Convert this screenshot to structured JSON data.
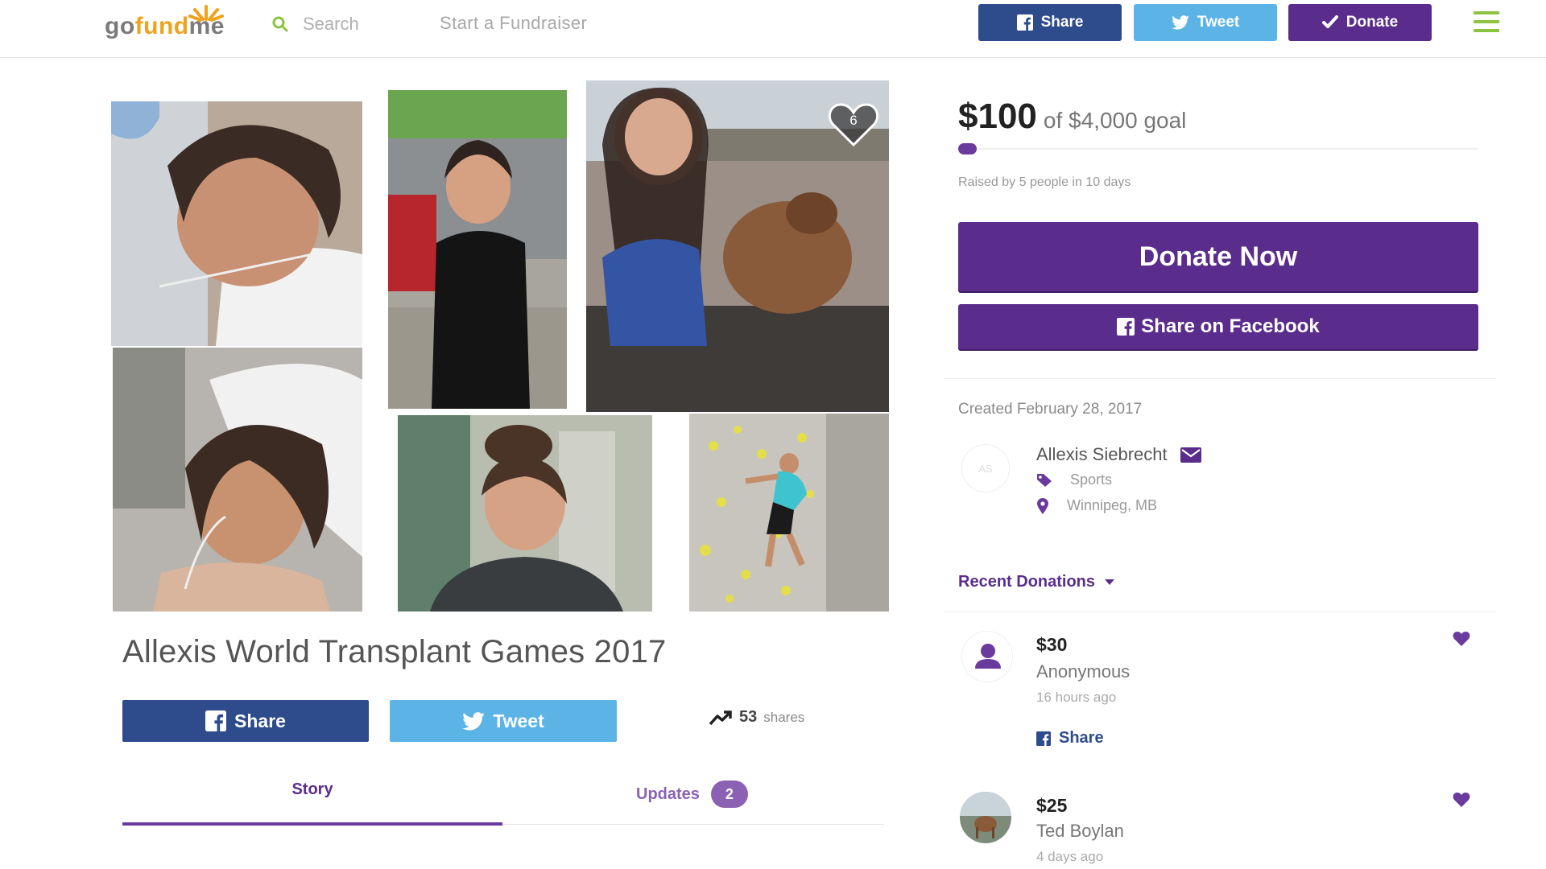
{
  "header": {
    "logo": {
      "go": "go",
      "fund": "fund",
      "me": "me"
    },
    "search_label": "Search",
    "start_link": "Start a Fundraiser",
    "share_label": "Share",
    "tweet_label": "Tweet",
    "donate_label": "Donate",
    "menu_icon": "hamburger-menu-icon"
  },
  "gallery": {
    "heart_count": "6",
    "photos": [
      "girl-in-hospital-bed-photo",
      "girl-in-black-dress-photo",
      "girl-with-dog-by-lake-photo",
      "girl-with-oxygen-tube-photo",
      "girl-portrait-photo",
      "girl-climbing-wall-photo"
    ]
  },
  "campaign": {
    "title": "Allexis World Transplant Games 2017",
    "share_label": "Share",
    "tweet_label": "Tweet",
    "shares_count": "53",
    "shares_label": "shares",
    "tabs": {
      "story": "Story",
      "updates": "Updates",
      "updates_count": "2"
    }
  },
  "funding": {
    "raised": "$100",
    "goal_text": "of $4,000 goal",
    "progress_fraction": 0.025,
    "raised_by": "Raised by 5 people in 10 days",
    "donate_now": "Donate Now",
    "share_facebook": "Share on Facebook"
  },
  "organizer": {
    "created": "Created February 28, 2017",
    "avatar_initials": "AS",
    "name": "Allexis Siebrecht",
    "category": "Sports",
    "location": "Winnipeg, MB"
  },
  "recent_donations": {
    "label": "Recent Donations",
    "items": [
      {
        "amount": "$30",
        "name": "Anonymous",
        "time": "16 hours ago",
        "share_label": "Share"
      },
      {
        "amount": "$25",
        "name": "Ted Boylan",
        "time": "4 days ago"
      }
    ]
  },
  "colors": {
    "purple": "#5a2d8c",
    "facebook_blue": "#2e4b8c",
    "twitter_blue": "#5bb4e5",
    "logo_orange": "#f0a21c",
    "menu_green": "#8cc43f"
  }
}
